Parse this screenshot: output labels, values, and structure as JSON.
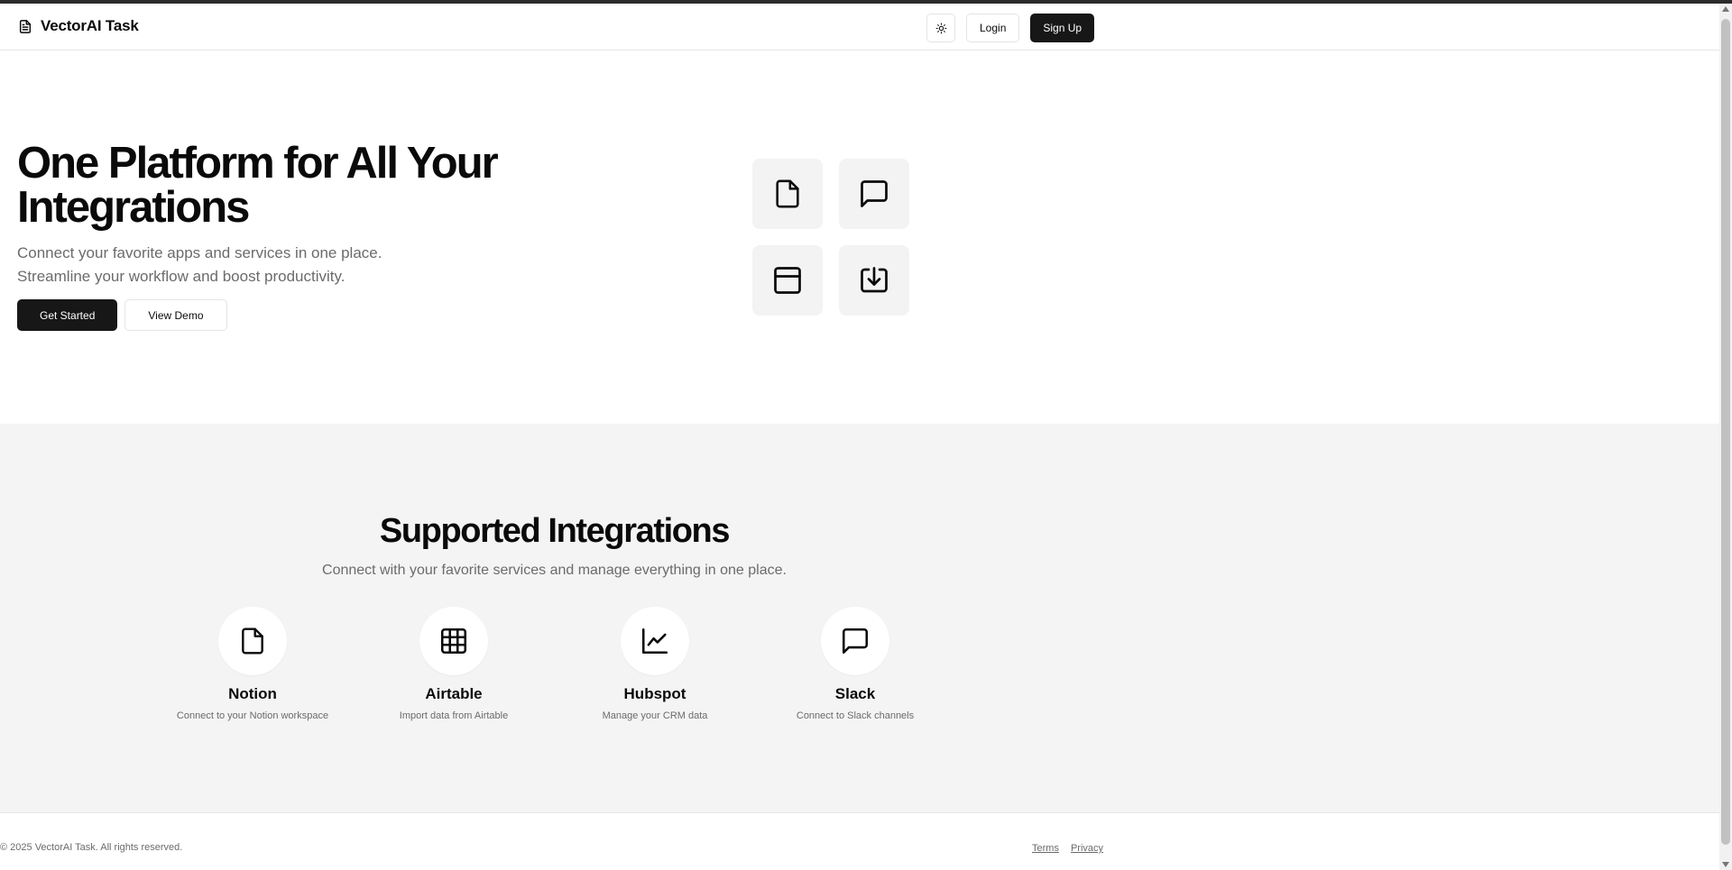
{
  "header": {
    "brand_icon": "file-text-icon",
    "brand_title": "VectorAI Task",
    "theme_toggle_icon": "sun-icon",
    "login_label": "Login",
    "signup_label": "Sign Up"
  },
  "hero": {
    "title": "One Platform for All Your Integrations",
    "subtitle_line1": "Connect your favorite apps and services in one place.",
    "subtitle_line2": "Streamline your workflow and boost productivity.",
    "get_started_label": "Get Started",
    "view_demo_label": "View Demo",
    "tiles": [
      "file-icon",
      "message-square-icon",
      "panel-top-icon",
      "download-box-icon"
    ]
  },
  "integrations": {
    "title": "Supported Integrations",
    "subtitle": "Connect with your favorite services and manage everything in one place.",
    "cards": [
      {
        "name": "Notion",
        "description": "Connect to your Notion workspace",
        "icon": "file-icon"
      },
      {
        "name": "Airtable",
        "description": "Import data from Airtable",
        "icon": "grid-icon"
      },
      {
        "name": "Hubspot",
        "description": "Manage your CRM data",
        "icon": "line-chart-icon"
      },
      {
        "name": "Slack",
        "description": "Connect to Slack channels",
        "icon": "message-square-icon"
      }
    ]
  },
  "footer": {
    "copyright": "© 2025 VectorAI Task. All rights reserved.",
    "terms_label": "Terms",
    "privacy_label": "Privacy"
  },
  "colors": {
    "primary": "#171717",
    "muted_text": "#6b6b6b",
    "section_bg": "#f4f4f4",
    "tile_bg": "#f3f3f3"
  }
}
